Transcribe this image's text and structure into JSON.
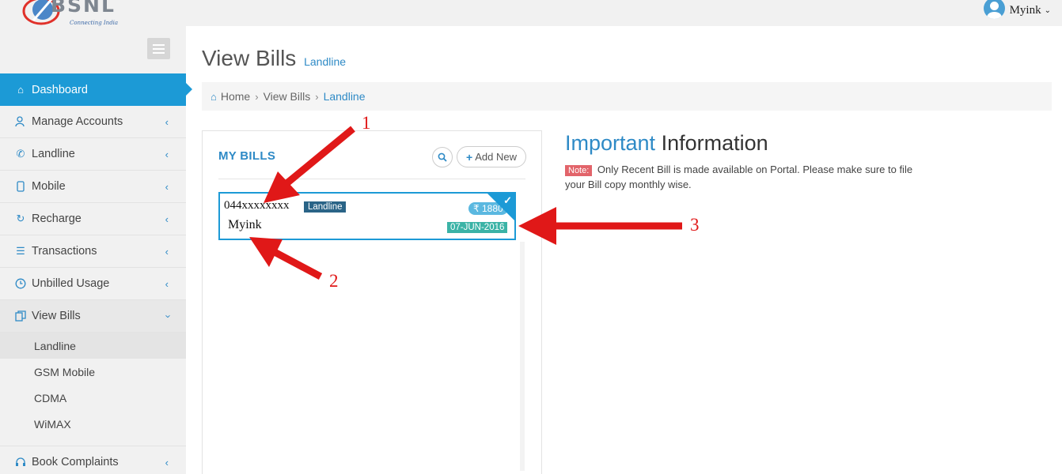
{
  "brand": {
    "name": "BSNL",
    "tagline": "Connecting India"
  },
  "user": {
    "name": "Myink"
  },
  "sidebar": {
    "items": [
      {
        "label": "Dashboard",
        "icon": "home-icon",
        "active": true
      },
      {
        "label": "Manage Accounts",
        "icon": "users-icon"
      },
      {
        "label": "Landline",
        "icon": "phone-icon"
      },
      {
        "label": "Mobile",
        "icon": "mobile-icon"
      },
      {
        "label": "Recharge",
        "icon": "refresh-icon"
      },
      {
        "label": "Transactions",
        "icon": "list-icon"
      },
      {
        "label": "Unbilled Usage",
        "icon": "clock-icon"
      },
      {
        "label": "View Bills",
        "icon": "copy-icon",
        "expanded": true
      }
    ],
    "subitems": [
      {
        "label": "Landline",
        "current": true
      },
      {
        "label": "GSM Mobile"
      },
      {
        "label": "CDMA"
      },
      {
        "label": "WiMAX"
      }
    ],
    "more_items": [
      {
        "label": "Book Complaints",
        "icon": "headset-icon"
      }
    ]
  },
  "page": {
    "title": "View Bills",
    "subtitle": "Landline"
  },
  "breadcrumb": {
    "home": "Home",
    "parent": "View Bills",
    "current": "Landline"
  },
  "bills_panel": {
    "title": "MY BILLS",
    "add_label": "Add New",
    "bills": [
      {
        "number": "044xxxxxxxx",
        "type": "Landline",
        "name": "Myink",
        "amount": "₹ 1880",
        "date": "07-JUN-2016"
      }
    ]
  },
  "info": {
    "title_highlight": "Important",
    "title_rest": "Information",
    "note_badge": "Note:",
    "note_text": "Only Recent Bill is made available on Portal. Please make sure to file your Bill copy monthly wise."
  },
  "annotations": {
    "labels": [
      "1",
      "2",
      "3"
    ],
    "color": "#e01818"
  },
  "colors": {
    "primary": "#1c9ad6",
    "link": "#2e8ac6",
    "type_badge": "#2a6487",
    "date_badge": "#3bb3a6",
    "note_badge": "#e2646a"
  }
}
